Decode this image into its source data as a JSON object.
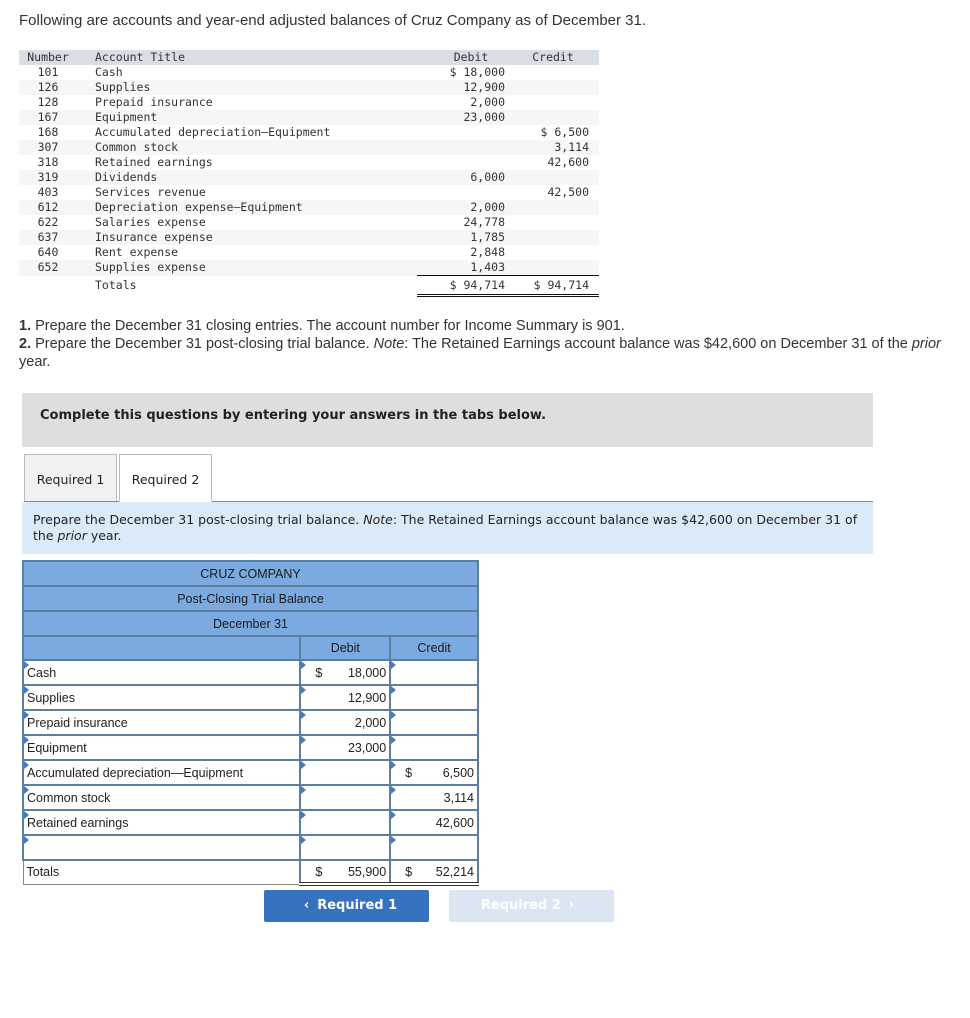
{
  "intro": "Following are accounts and year-end adjusted balances of Cruz Company as of December 31.",
  "account_table": {
    "headers": {
      "number": "Number",
      "title": "Account Title",
      "debit": "Debit",
      "credit": "Credit"
    },
    "rows": [
      {
        "number": "101",
        "title": "Cash",
        "debit": "$ 18,000",
        "credit": ""
      },
      {
        "number": "126",
        "title": "Supplies",
        "debit": "12,900",
        "credit": ""
      },
      {
        "number": "128",
        "title": "Prepaid insurance",
        "debit": "2,000",
        "credit": ""
      },
      {
        "number": "167",
        "title": "Equipment",
        "debit": "23,000",
        "credit": ""
      },
      {
        "number": "168",
        "title": "Accumulated depreciation—Equipment",
        "debit": "",
        "credit": "$ 6,500"
      },
      {
        "number": "307",
        "title": "Common stock",
        "debit": "",
        "credit": "3,114"
      },
      {
        "number": "318",
        "title": "Retained earnings",
        "debit": "",
        "credit": "42,600"
      },
      {
        "number": "319",
        "title": "Dividends",
        "debit": "6,000",
        "credit": ""
      },
      {
        "number": "403",
        "title": "Services revenue",
        "debit": "",
        "credit": "42,500"
      },
      {
        "number": "612",
        "title": "Depreciation expense—Equipment",
        "debit": "2,000",
        "credit": ""
      },
      {
        "number": "622",
        "title": "Salaries expense",
        "debit": "24,778",
        "credit": ""
      },
      {
        "number": "637",
        "title": "Insurance expense",
        "debit": "1,785",
        "credit": ""
      },
      {
        "number": "640",
        "title": "Rent expense",
        "debit": "2,848",
        "credit": ""
      },
      {
        "number": "652",
        "title": "Supplies expense",
        "debit": "1,403",
        "credit": ""
      }
    ],
    "totals": {
      "label": "Totals",
      "debit": "$ 94,714",
      "credit": "$ 94,714"
    }
  },
  "questions": {
    "q1_num": "1.",
    "q1_text": " Prepare the December 31 closing entries. The account number for Income Summary is 901.",
    "q2_num": "2.",
    "q2_text_a": " Prepare the December 31 post-closing trial balance. ",
    "q2_note": "Note",
    "q2_text_b": ": The Retained Earnings account balance was $42,600 on December 31 of the ",
    "q2_prior": "prior",
    "q2_text_c": " year."
  },
  "banner": "Complete this questions by entering your answers in the tabs below.",
  "tabs": [
    {
      "label": "Required 1",
      "active": false
    },
    {
      "label": "Required 2",
      "active": true
    }
  ],
  "instruction": {
    "a": "Prepare the December 31 post-closing trial balance. ",
    "note": "Note",
    "b": ": The Retained Earnings account balance was $42,600 on December 31 of the ",
    "prior": "prior",
    "c": " year."
  },
  "pctb": {
    "company": "CRUZ COMPANY",
    "statement": "Post-Closing Trial Balance",
    "date": "December 31",
    "debit_header": "Debit",
    "credit_header": "Credit",
    "rows": [
      {
        "account": "Cash",
        "debit_sym": "$",
        "debit": "18,000",
        "credit_sym": "",
        "credit": ""
      },
      {
        "account": "Supplies",
        "debit_sym": "",
        "debit": "12,900",
        "credit_sym": "",
        "credit": ""
      },
      {
        "account": "Prepaid insurance",
        "debit_sym": "",
        "debit": "2,000",
        "credit_sym": "",
        "credit": ""
      },
      {
        "account": "Equipment",
        "debit_sym": "",
        "debit": "23,000",
        "credit_sym": "",
        "credit": ""
      },
      {
        "account": "Accumulated depreciation—Equipment",
        "debit_sym": "",
        "debit": "",
        "credit_sym": "$",
        "credit": "6,500"
      },
      {
        "account": "Common stock",
        "debit_sym": "",
        "debit": "",
        "credit_sym": "",
        "credit": "3,114"
      },
      {
        "account": "Retained earnings",
        "debit_sym": "",
        "debit": "",
        "credit_sym": "",
        "credit": "42,600"
      },
      {
        "account": "",
        "debit_sym": "",
        "debit": "",
        "credit_sym": "",
        "credit": ""
      }
    ],
    "totals": {
      "label": "Totals",
      "debit_sym": "$",
      "debit": "55,900",
      "credit_sym": "$",
      "credit": "52,214"
    }
  },
  "nav": {
    "prev_label": "Required 1",
    "prev_icon": "chevron-left-icon",
    "next_label": "Required 2",
    "next_icon": "chevron-right-icon"
  }
}
